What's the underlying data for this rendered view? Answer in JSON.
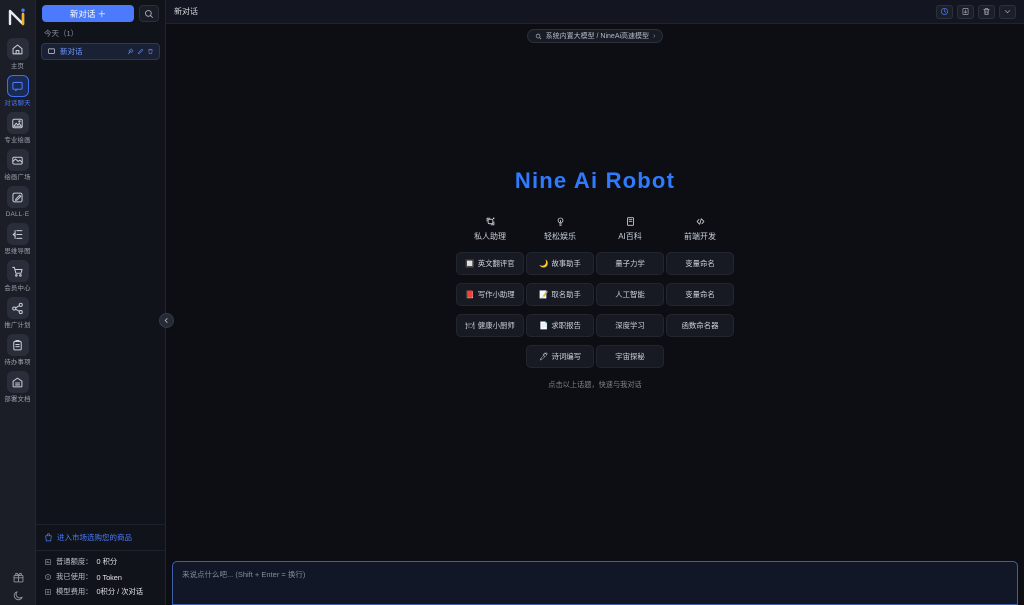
{
  "rail": {
    "logo_icon": "nine-ai-logo",
    "items": [
      {
        "label": "主页",
        "icon": "home-icon",
        "active": false
      },
      {
        "label": "对话聊天",
        "icon": "chat-bubble-icon",
        "active": true
      },
      {
        "label": "专业绘画",
        "icon": "image-mountain-icon",
        "active": false
      },
      {
        "label": "绘画广场",
        "icon": "gallery-icon",
        "active": false
      },
      {
        "label": "DALL·E",
        "icon": "pen-image-icon",
        "active": false
      },
      {
        "label": "思维导图",
        "icon": "mindmap-icon",
        "active": false
      },
      {
        "label": "会员中心",
        "icon": "cart-icon",
        "active": false
      },
      {
        "label": "推广计划",
        "icon": "share-nodes-icon",
        "active": false
      },
      {
        "label": "待办事项",
        "icon": "clipboard-icon",
        "active": false
      },
      {
        "label": "部署文档",
        "icon": "doc-archive-icon",
        "active": false
      }
    ],
    "bottom": [
      {
        "icon": "gift-icon"
      },
      {
        "icon": "moon-icon"
      }
    ]
  },
  "sidebar": {
    "new_chat_label": "新对话 ＋",
    "search_icon": "search-icon",
    "group_label": "今天（1）",
    "conversations": [
      {
        "title": "新对话",
        "icon": "chat-square-icon",
        "actions": [
          "pin-icon",
          "edit-icon",
          "delete-icon"
        ]
      }
    ],
    "market_link": "进入市场选购您的商品",
    "market_icon": "shop-bag-icon",
    "stats": [
      {
        "icon": "quota-icon",
        "label": "普通额度：",
        "value": "0 积分"
      },
      {
        "icon": "token-icon",
        "label": "我已使用：",
        "value": "0 Token"
      },
      {
        "icon": "price-icon",
        "label": "模型费用：",
        "value": "0积分 / 次对话"
      }
    ],
    "collapse_icon": "chevron-left-icon"
  },
  "header": {
    "title": "新对话",
    "actions": [
      {
        "icon": "history-clock-icon",
        "primary": true
      },
      {
        "icon": "download-icon",
        "primary": false
      },
      {
        "icon": "trash-icon",
        "primary": false
      },
      {
        "icon": "chevron-down-icon",
        "primary": false
      }
    ]
  },
  "model_selector": {
    "icon": "model-search-icon",
    "label": "系统内置大模型 / NineAi高速模型",
    "chevron": "›"
  },
  "welcome": {
    "brand": "Nine Ai Robot",
    "categories": [
      {
        "label": "私人助理",
        "icon": "assistant-icon"
      },
      {
        "label": "轻松娱乐",
        "icon": "bulb-icon"
      },
      {
        "label": "AI百科",
        "icon": "book-icon"
      },
      {
        "label": "前端开发",
        "icon": "code-icon"
      }
    ],
    "columns": [
      {
        "category": "私人助理",
        "cards": [
          {
            "emoji": "🔲",
            "label": "英文翻评官"
          },
          {
            "emoji": "📕",
            "label": "写作小助理"
          },
          {
            "emoji": "🍽",
            "label": "健康小厨师"
          }
        ]
      },
      {
        "category": "轻松娱乐",
        "cards": [
          {
            "emoji": "🌙",
            "label": "故事助手"
          },
          {
            "emoji": "📝",
            "label": "取名助手"
          },
          {
            "emoji": "📄",
            "label": "求职报告"
          },
          {
            "emoji": "🖊",
            "label": "诗词编写"
          }
        ]
      },
      {
        "category": "AI百科",
        "cards": [
          {
            "emoji": "",
            "label": "量子力学"
          },
          {
            "emoji": "",
            "label": "人工智能"
          },
          {
            "emoji": "",
            "label": "深度学习"
          },
          {
            "emoji": "",
            "label": "宇宙探秘"
          }
        ]
      },
      {
        "category": "前端开发",
        "cards": [
          {
            "emoji": "",
            "label": "变量命名"
          },
          {
            "emoji": "",
            "label": "变量命名"
          },
          {
            "emoji": "",
            "label": "函数命名器"
          }
        ]
      }
    ],
    "hint": "点击以上话题，快速与我对话"
  },
  "composer": {
    "placeholder": "来说点什么吧... (Shift + Enter = 换行)"
  },
  "colors": {
    "accent": "#4b7bfc",
    "brand": "#2f7bff",
    "rail_bg": "#1b1e27",
    "sidebar_bg": "#10131a",
    "main_bg": "#0c0e14"
  }
}
